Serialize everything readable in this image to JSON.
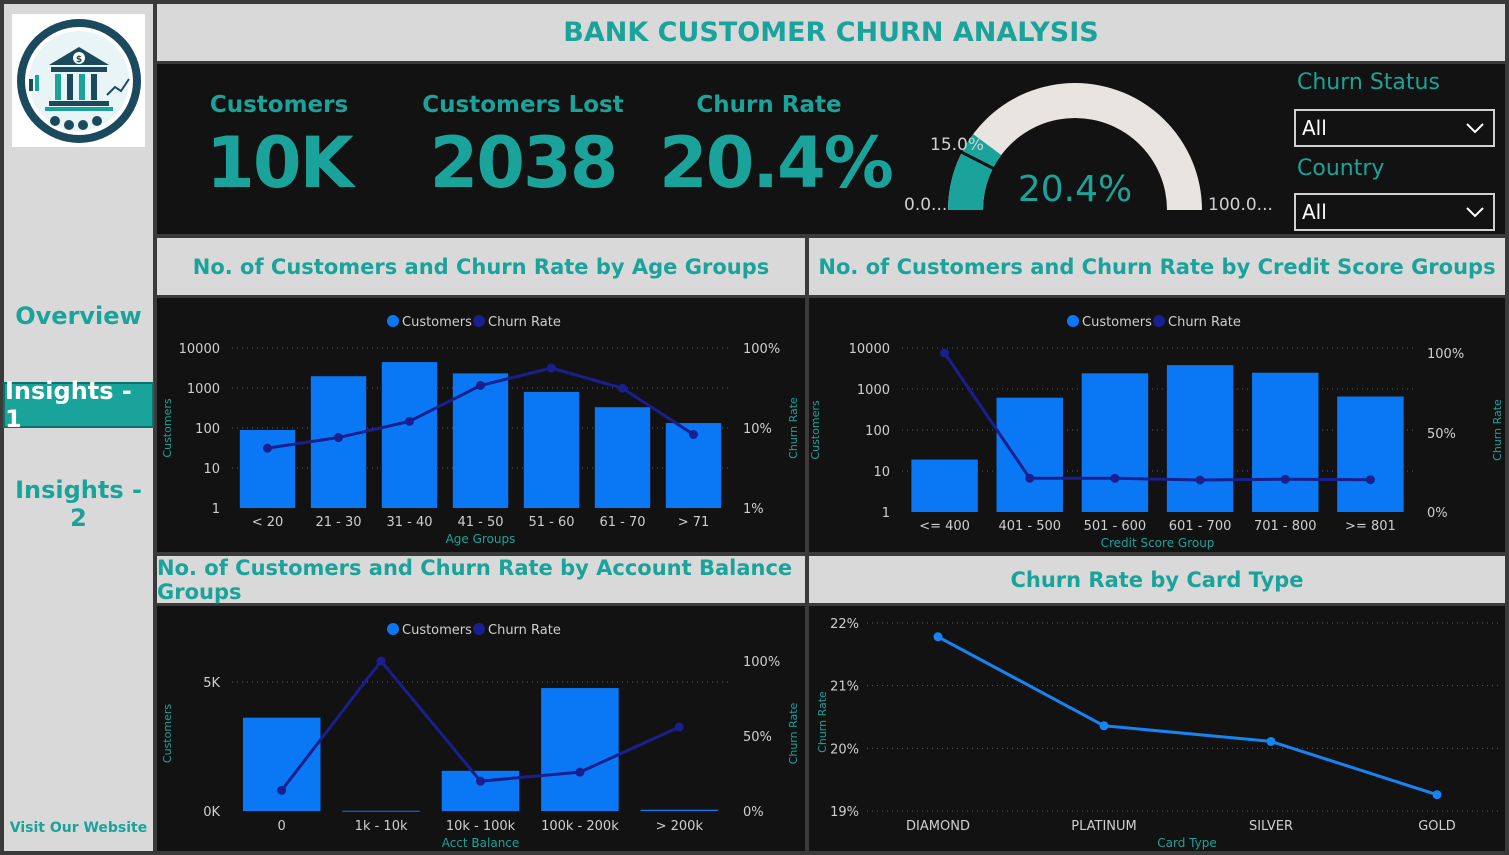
{
  "sidebar": {
    "nav": [
      {
        "label": "Overview"
      },
      {
        "label": "Insights - 1"
      },
      {
        "label": "Insights - 2"
      }
    ],
    "visit_link": "Visit Our Website"
  },
  "title": "BANK CUSTOMER CHURN ANALYSIS",
  "kpis": {
    "customers": {
      "label": "Customers",
      "value": "10K"
    },
    "lost": {
      "label": "Customers Lost",
      "value": "2038"
    },
    "rate": {
      "label": "Churn Rate",
      "value": "20.4%"
    }
  },
  "gauge": {
    "value_label": "20.4%",
    "min_label": "0.0...",
    "max_label": "100.0...",
    "target_label": "15.0%",
    "value": 20.4,
    "target": 15.0,
    "min": 0,
    "max": 100
  },
  "filters": {
    "churn_status": {
      "label": "Churn Status",
      "value": "All"
    },
    "country": {
      "label": "Country",
      "value": "All"
    }
  },
  "colors": {
    "teal": "#1aa39b",
    "bar": "#0a78f5",
    "line": "#1a1f8f",
    "panel": "#121212",
    "header": "#d9d9d9",
    "card_line": "#1684f5"
  },
  "legend": {
    "customers": "Customers",
    "churn": "Churn Rate"
  },
  "chart_data": [
    {
      "type": "bar",
      "title": "No. of Customers and Churn Rate by Age Groups",
      "xlabel": "Age Groups",
      "ylabel": "Customers",
      "y2label": "Churn Rate",
      "scale": "log",
      "categories": [
        "< 20",
        "21 - 30",
        "31 - 40",
        "41 - 50",
        "51 - 60",
        "61 - 70",
        "> 71"
      ],
      "y_ticks": [
        "10000",
        "1000",
        "100",
        "10",
        "1"
      ],
      "y2_ticks": [
        "100%",
        "10%",
        "1%"
      ],
      "series": [
        {
          "name": "Customers",
          "values": [
            89,
            1968,
            4451,
            2320,
            797,
            331,
            133
          ]
        },
        {
          "name": "Churn Rate",
          "values": [
            5.6,
            7.6,
            12.1,
            34.0,
            56.2,
            31.4,
            8.3
          ]
        }
      ]
    },
    {
      "type": "bar",
      "title": "No. of Customers and Churn Rate by Credit Score Groups",
      "xlabel": "Credit Score Group",
      "ylabel": "Customers",
      "y2label": "Churn Rate",
      "scale": "log",
      "categories": [
        "<= 400",
        "401 - 500",
        "501 - 600",
        "601 - 700",
        "701 - 800",
        ">= 801"
      ],
      "y_ticks": [
        "10000",
        "1000",
        "100",
        "10",
        "1"
      ],
      "y2_ticks": [
        "100%",
        "50%",
        "0%"
      ],
      "series": [
        {
          "name": "Customers",
          "values": [
            19,
            614,
            2410,
            3818,
            2493,
            655
          ]
        },
        {
          "name": "Churn Rate",
          "values": [
            100,
            21.2,
            21.2,
            20.1,
            20.6,
            20.3
          ]
        }
      ]
    },
    {
      "type": "bar",
      "title": "No. of Customers and Churn Rate by Account Balance Groups",
      "xlabel": "Acct Balance",
      "ylabel": "Customers",
      "y2label": "Churn Rate",
      "categories": [
        "0",
        "1k - 10k",
        "10k - 100k",
        "100k - 200k",
        "> 200k"
      ],
      "y_ticks": [
        "5K",
        "0K"
      ],
      "y2_ticks": [
        "100%",
        "50%",
        "0%"
      ],
      "ylim": [
        0,
        6000
      ],
      "series": [
        {
          "name": "Customers",
          "values": [
            3617,
            10,
            1558,
            4765,
            50
          ]
        },
        {
          "name": "Churn Rate",
          "values": [
            13.8,
            100,
            19.9,
            25.9,
            56.0
          ]
        }
      ]
    },
    {
      "type": "line",
      "title": "Churn Rate by Card Type",
      "xlabel": "Card Type",
      "ylabel": "Churn Rate",
      "categories": [
        "DIAMOND",
        "PLATINUM",
        "SILVER",
        "GOLD"
      ],
      "y_ticks": [
        "22%",
        "21%",
        "20%",
        "19%"
      ],
      "ylim": [
        19,
        22
      ],
      "series": [
        {
          "name": "Churn Rate",
          "values": [
            21.78,
            20.36,
            20.11,
            19.26
          ]
        }
      ]
    }
  ]
}
